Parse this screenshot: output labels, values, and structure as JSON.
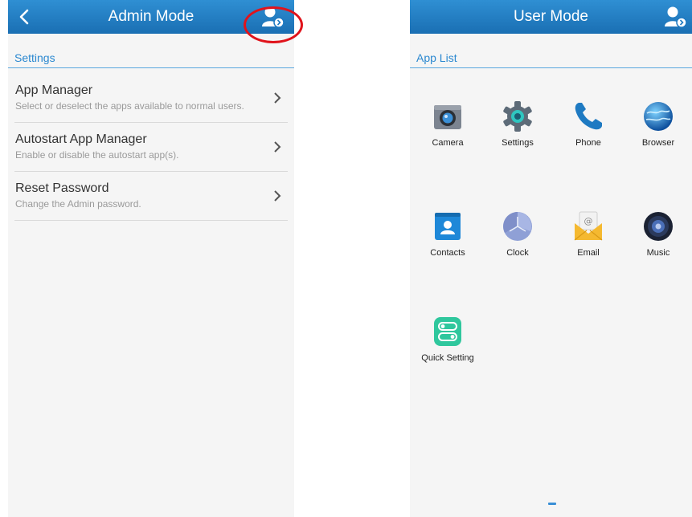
{
  "admin": {
    "title": "Admin Mode",
    "section": "Settings",
    "items": [
      {
        "title": "App Manager",
        "subtitle": "Select or deselect the apps available to normal users."
      },
      {
        "title": "Autostart App Manager",
        "subtitle": "Enable or disable the autostart app(s)."
      },
      {
        "title": "Reset Password",
        "subtitle": "Change the Admin password."
      }
    ]
  },
  "user": {
    "title": "User Mode",
    "section": "App List",
    "apps": [
      {
        "label": "Camera",
        "icon": "camera-icon"
      },
      {
        "label": "Settings",
        "icon": "gear-icon"
      },
      {
        "label": "Phone",
        "icon": "phone-icon"
      },
      {
        "label": "Browser",
        "icon": "globe-icon"
      },
      {
        "label": "Contacts",
        "icon": "contacts-icon"
      },
      {
        "label": "Clock",
        "icon": "clock-icon"
      },
      {
        "label": "Email",
        "icon": "email-icon"
      },
      {
        "label": "Music",
        "icon": "speaker-icon"
      },
      {
        "label": "Quick Setting",
        "icon": "toggle-icon"
      }
    ]
  },
  "colors": {
    "appbar": "#1e7ac2",
    "accent": "#2b88d0",
    "highlight": "#e0131b"
  }
}
